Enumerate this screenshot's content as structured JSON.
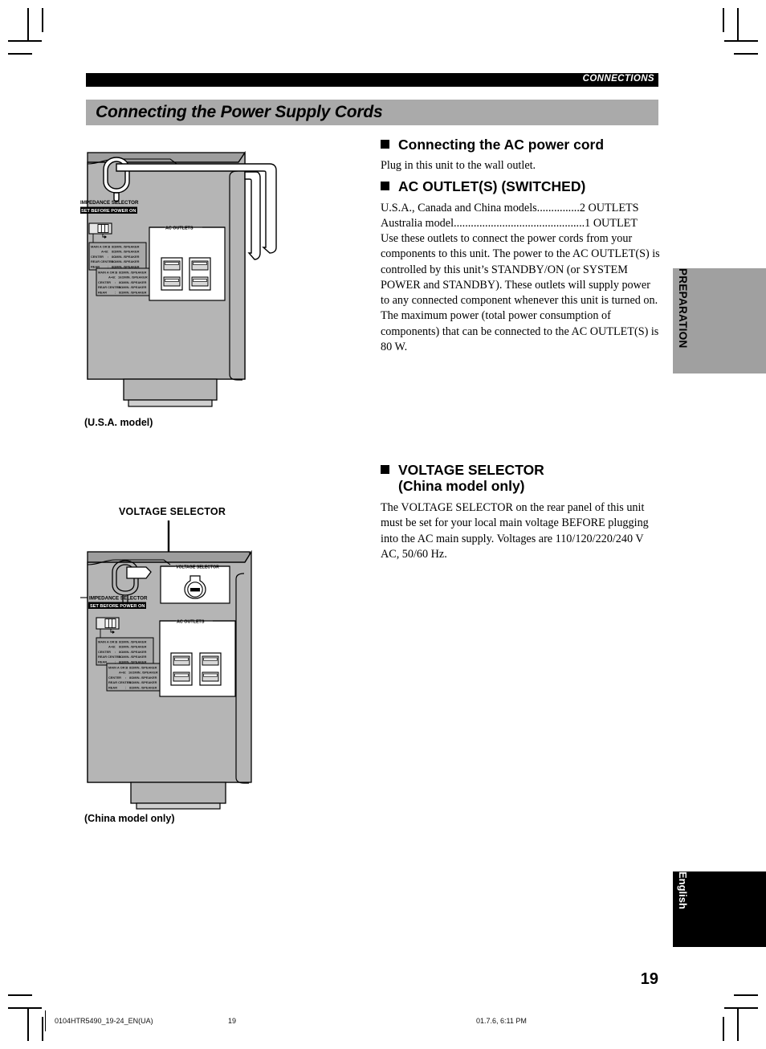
{
  "header": {
    "running_head": "CONNECTIONS",
    "section_title": "Connecting the Power Supply Cords"
  },
  "sections": [
    {
      "heading": "Connecting the AC power cord",
      "paragraphs": [
        "Plug in this unit to the wall outlet."
      ]
    },
    {
      "heading": "AC OUTLET(S) (SWITCHED)",
      "dot_lines": [
        {
          "label": "U.S.A., Canada and China models",
          "dots": "...............",
          "value": "2 OUTLETS"
        },
        {
          "label": "Australia model",
          "dots": "..............................................",
          "value": "1 OUTLET"
        }
      ],
      "paragraphs": [
        "Use these outlets to connect the power cords from your components to this unit. The power to the AC OUTLET(S) is controlled by this unit’s STANDBY/ON (or SYSTEM POWER and STANDBY). These outlets will supply power to any connected component whenever this unit is turned on. The maximum power (total power consumption of components) that can be connected to the AC OUTLET(S) is 80 W."
      ]
    },
    {
      "heading_line1": "VOLTAGE SELECTOR",
      "heading_line2": "(China model only)",
      "paragraphs": [
        "The VOLTAGE SELECTOR on the rear panel of this unit must be set for your local main voltage BEFORE plugging into the AC main supply. Voltages are 110/120/220/240 V AC, 50/60 Hz."
      ]
    }
  ],
  "figures": [
    {
      "caption": "(U.S.A. model)",
      "labels": {
        "impedance_selector": "IMPEDANCE SELECTOR",
        "set_before_power_on": "SET BEFORE POWER ON",
        "ac_outlets": "AC OUTLETS"
      },
      "impedance_table_a": [
        {
          "ch": "MAIN  A OR B",
          "sep": ":",
          "val": "8ΩMIN. /SPEAKER"
        },
        {
          "ch": "A+B",
          "sep": ":",
          "val": "8ΩMIN. /SPEAKER"
        },
        {
          "ch": "CENTER",
          "sep": ":",
          "val": "8ΩMIN. /SPEAKER"
        },
        {
          "ch": "REAR CENTER",
          "sep": ":",
          "val": "8ΩMIN. /SPEAKER"
        },
        {
          "ch": "REAR",
          "sep": ":",
          "val": "8ΩMIN. /SPEAKER"
        }
      ],
      "impedance_table_b": [
        {
          "ch": "MAIN  A OR B",
          "sep": ":",
          "val": "8ΩMIN. /SPEAKER"
        },
        {
          "ch": "A+B",
          "sep": ":",
          "val": "16ΩMIN. /SPEAKER"
        },
        {
          "ch": "CENTER",
          "sep": ":",
          "val": "8ΩMIN. /SPEAKER"
        },
        {
          "ch": "REAR CENTER",
          "sep": ":",
          "val": "8ΩMIN. /SPEAKER"
        },
        {
          "ch": "REAR",
          "sep": ":",
          "val": "8ΩMIN. /SPEAKER"
        }
      ]
    },
    {
      "caption": "(China model only)",
      "callout": "VOLTAGE SELECTOR",
      "labels": {
        "impedance_selector": "IMPEDANCE SELECTOR",
        "set_before_power_on": "SET BEFORE POWER ON",
        "ac_outlets": "AC OUTLETS",
        "voltage_selector": "VOLTAGE SELECTOR"
      },
      "impedance_table_a": [
        {
          "ch": "MAIN  A OR B",
          "sep": ":",
          "val": "8ΩMIN. /SPEAKER"
        },
        {
          "ch": "A+B",
          "sep": ":",
          "val": "8ΩMIN. /SPEAKER"
        },
        {
          "ch": "CENTER",
          "sep": ":",
          "val": "8ΩMIN. /SPEAKER"
        },
        {
          "ch": "REAR CENTER",
          "sep": ":",
          "val": "8ΩMIN. /SPEAKER"
        },
        {
          "ch": "REAR",
          "sep": ":",
          "val": "8ΩMIN. /SPEAKER"
        }
      ],
      "impedance_table_b": [
        {
          "ch": "MAIN  A OR B",
          "sep": ":",
          "val": "8ΩMIN. /SPEAKER"
        },
        {
          "ch": "A+B",
          "sep": ":",
          "val": "16ΩMIN. /SPEAKER"
        },
        {
          "ch": "CENTER",
          "sep": ":",
          "val": "8ΩMIN. /SPEAKER"
        },
        {
          "ch": "REAR CENTER",
          "sep": ":",
          "val": "8ΩMIN. /SPEAKER"
        },
        {
          "ch": "REAR",
          "sep": ":",
          "val": "8ΩMIN. /SPEAKER"
        }
      ]
    }
  ],
  "side_tabs": {
    "preparation": "PREPARATION",
    "english": "English"
  },
  "page_number": "19",
  "footer": {
    "file": "0104HTR5490_19-24_EN(UA)",
    "page": "19",
    "date": "01.7.6, 6:11 PM"
  },
  "colors": {
    "head_bar": "#000000",
    "title_band": "#aaaaaa",
    "tab_preparation": "#a0a0a0",
    "tab_english": "#000000",
    "panel_face": "#b5b5b5",
    "panel_face_dark": "#a2a2a2"
  }
}
